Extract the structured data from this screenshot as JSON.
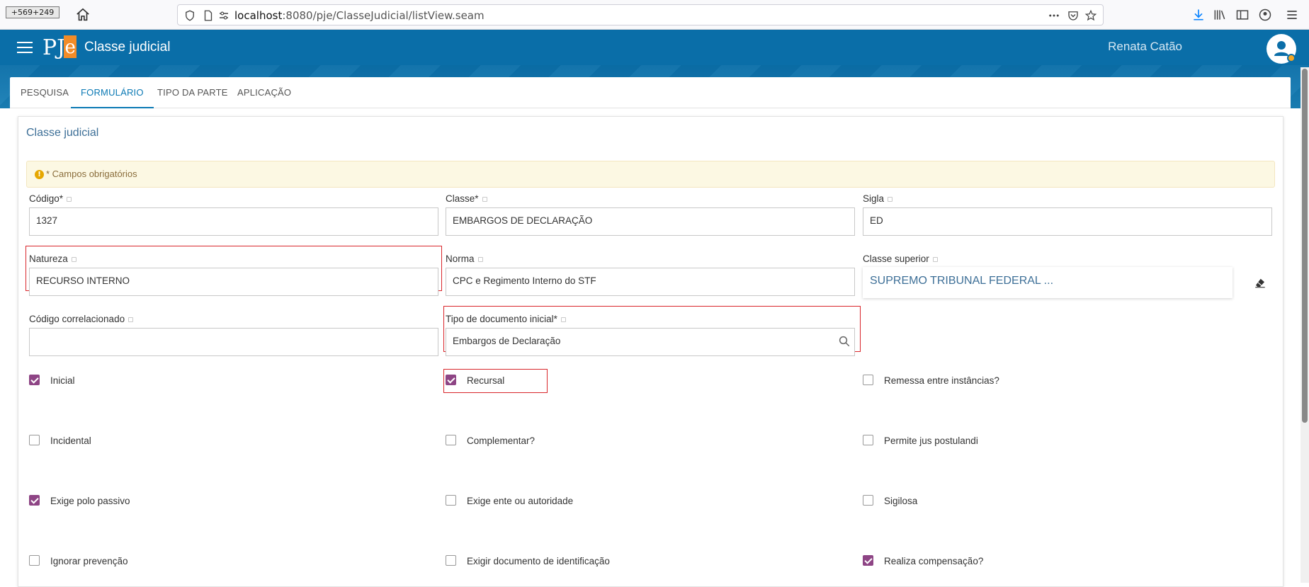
{
  "browser": {
    "coords": "+569+249",
    "url_host": "localhost",
    "url_rest": ":8080/pje/ClasseJudicial/listView.seam"
  },
  "header": {
    "logo_text": "PJ",
    "logo_e": "e",
    "title": "Classe judicial",
    "user": "Renata Catão",
    "brand_color": "#0a6ea8",
    "status_color": "#f5a623"
  },
  "tabs": [
    {
      "label": "PESQUISA"
    },
    {
      "label": "FORMULÁRIO",
      "active": true
    },
    {
      "label": "TIPO DA PARTE"
    },
    {
      "label": "APLICAÇÃO"
    }
  ],
  "form": {
    "title": "Classe judicial",
    "notice": "* Campos obrigatórios",
    "fields": {
      "codigo": {
        "label": "Código*",
        "value": "1327"
      },
      "classe": {
        "label": "Classe*",
        "value": "EMBARGOS DE DECLARAÇÃO"
      },
      "sigla": {
        "label": "Sigla",
        "value": "ED"
      },
      "natureza": {
        "label": "Natureza",
        "value": "RECURSO INTERNO"
      },
      "norma": {
        "label": "Norma",
        "value": "CPC e Regimento Interno do STF"
      },
      "classe_superior": {
        "label": "Classe superior",
        "value": "SUPREMO TRIBUNAL FEDERAL ..."
      },
      "codigo_correlacionado": {
        "label": "Código correlacionado",
        "value": ""
      },
      "tipo_documento": {
        "label": "Tipo de documento inicial*",
        "value": "Embargos de Declaração"
      }
    },
    "checkboxes": {
      "inicial": {
        "label": "Inicial",
        "checked": true
      },
      "recursal": {
        "label": "Recursal",
        "checked": true
      },
      "remessa": {
        "label": "Remessa entre instâncias?",
        "checked": false
      },
      "incidental": {
        "label": "Incidental",
        "checked": false
      },
      "complementar": {
        "label": "Complementar?",
        "checked": false
      },
      "jus_postulandi": {
        "label": "Permite jus postulandi",
        "checked": false
      },
      "polo_passivo": {
        "label": "Exige polo passivo",
        "checked": true
      },
      "ente_autoridade": {
        "label": "Exige ente ou autoridade",
        "checked": false
      },
      "sigilosa": {
        "label": "Sigilosa",
        "checked": false
      },
      "ignorar_prevencao": {
        "label": "Ignorar prevenção",
        "checked": false
      },
      "documento_identificacao": {
        "label": "Exigir documento de identificação",
        "checked": false
      },
      "compensacao": {
        "label": "Realiza compensação?",
        "checked": true
      }
    },
    "accent_color": "#8e4585",
    "highlight_color": "#d9262b"
  }
}
